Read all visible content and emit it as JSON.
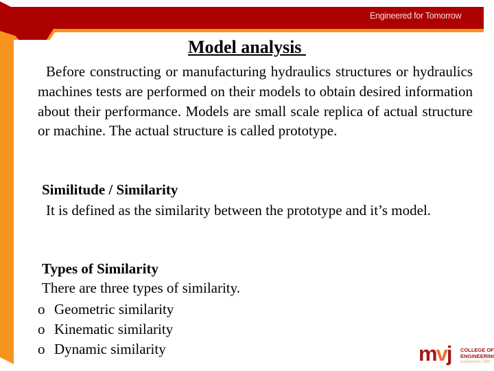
{
  "header": {
    "tagline": "Engineered for Tomorrow",
    "colors": {
      "banner": "#ad0000",
      "accent": "#f7941d"
    }
  },
  "slide": {
    "title": "Model analysis ",
    "intro_paragraph": "Before constructing or manufacturing hydraulics structures or hydraulics machines tests are performed on their models to obtain desired information about their performance. Models are small scale replica of actual structure or machine. The actual structure is called prototype.",
    "sections": [
      {
        "heading": "Similitude / Similarity",
        "text": "It is defined as the similarity between the prototype and it’s model."
      },
      {
        "heading": "Types of Similarity",
        "text": "There are three types of similarity.",
        "bullet_symbol": "o",
        "items": [
          "Geometric similarity",
          "Kinematic similarity",
          "Dynamic similarity"
        ]
      }
    ]
  },
  "logo": {
    "letters": [
      "m",
      "v",
      "j"
    ],
    "line1": "COLLEGE OF",
    "line2": "ENGINEERING",
    "established": "Established in 1982"
  }
}
